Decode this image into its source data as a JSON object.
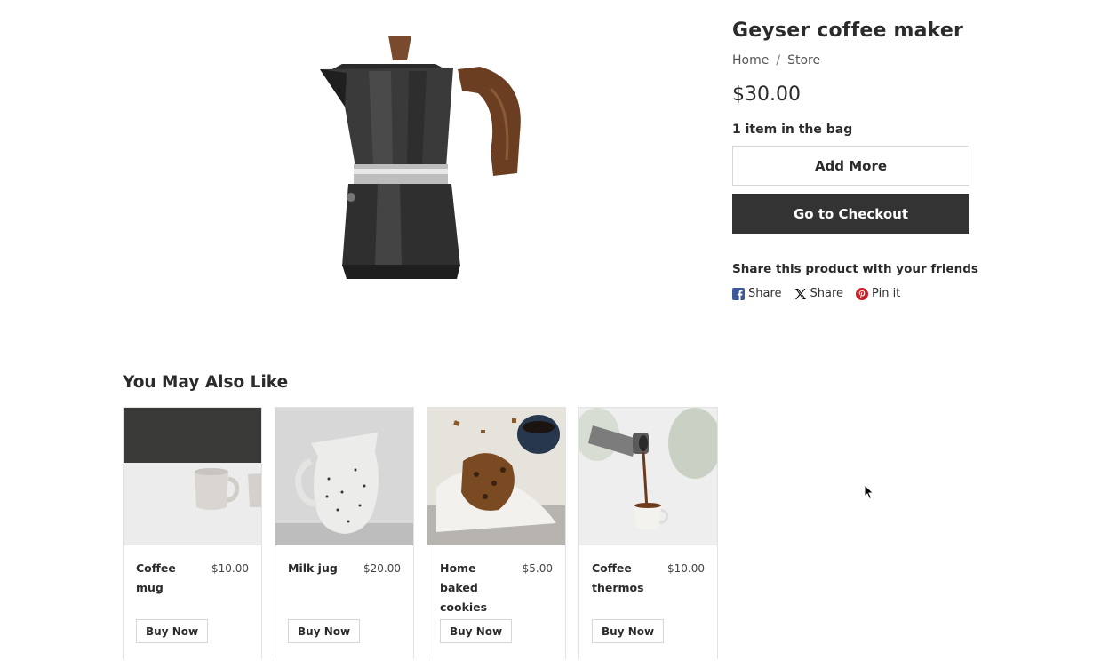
{
  "product": {
    "title": "Geyser coffee maker",
    "price": "$30.00",
    "image_icon": "moka-pot-image"
  },
  "breadcrumb": {
    "home": "Home",
    "separator": "/",
    "store": "Store"
  },
  "cart": {
    "bag_status": "1 item in the bag",
    "add_more_label": "Add More",
    "checkout_label": "Go to Checkout"
  },
  "share": {
    "heading": "Share this product with your friends",
    "items": [
      {
        "label": "Share",
        "icon": "facebook-icon",
        "color": "#3b5998"
      },
      {
        "label": "Share",
        "icon": "x-icon",
        "color": "#000000"
      },
      {
        "label": "Pin it",
        "icon": "pinterest-icon",
        "color": "#cb2027"
      }
    ]
  },
  "recommendations": {
    "title": "You May Also Like",
    "items": [
      {
        "name": "Coffee mug",
        "price": "$10.00",
        "button": "Buy Now",
        "image": "coffee-mug-photo"
      },
      {
        "name": "Milk jug",
        "price": "$20.00",
        "button": "Buy Now",
        "image": "milk-jug-photo"
      },
      {
        "name": "Home baked cookies",
        "price": "$5.00",
        "button": "Buy Now",
        "image": "cookies-photo"
      },
      {
        "name": "Coffee thermos",
        "price": "$10.00",
        "button": "Buy Now",
        "image": "thermos-photo"
      }
    ]
  },
  "colors": {
    "text": "#2b2b2b",
    "checkout_bg": "#333333",
    "border": "#d6d6d6"
  }
}
